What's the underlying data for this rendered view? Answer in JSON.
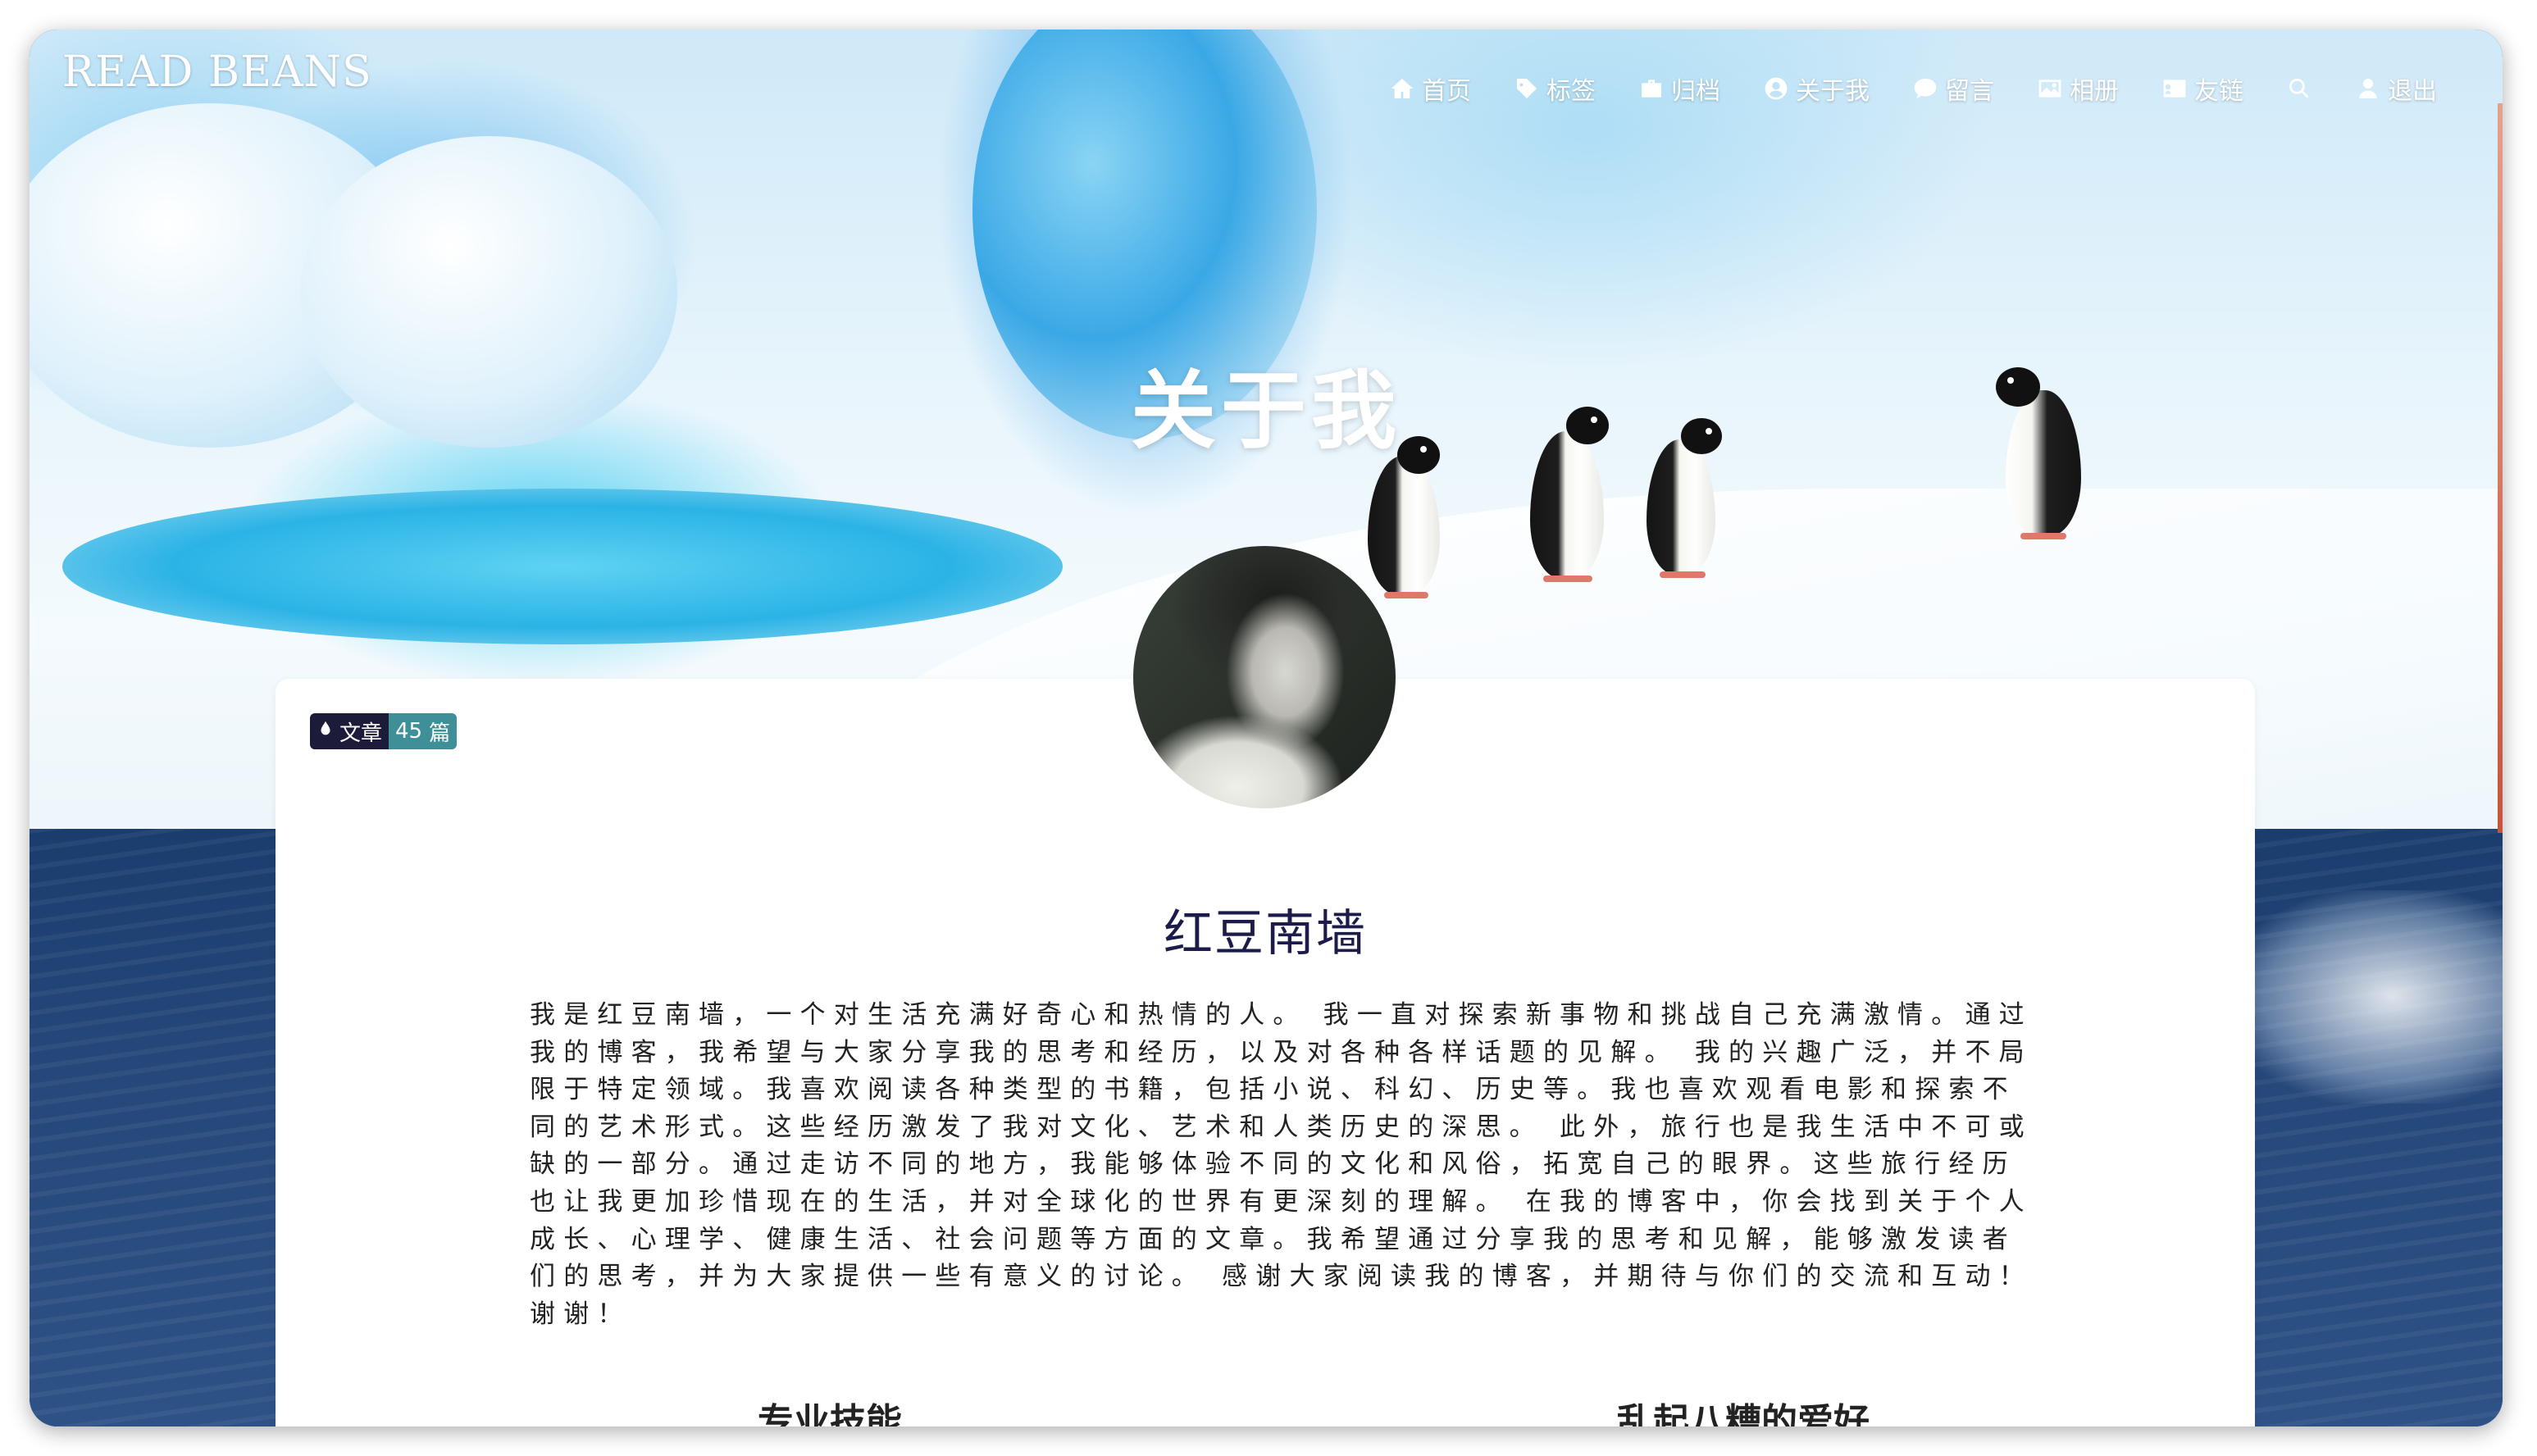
{
  "site": {
    "logo": "READ BEANS"
  },
  "nav": {
    "items": [
      {
        "label": "首页",
        "icon": "home-icon"
      },
      {
        "label": "标签",
        "icon": "tag-icon"
      },
      {
        "label": "归档",
        "icon": "briefcase-icon"
      },
      {
        "label": "关于我",
        "icon": "user-circle-icon"
      },
      {
        "label": "留言",
        "icon": "comment-icon"
      },
      {
        "label": "相册",
        "icon": "image-icon"
      },
      {
        "label": "友链",
        "icon": "id-card-icon"
      },
      {
        "label": "",
        "icon": "search-icon"
      },
      {
        "label": "退出",
        "icon": "user-icon"
      }
    ]
  },
  "hero": {
    "title": "关于我"
  },
  "card": {
    "badge": {
      "label": "文章",
      "count": "45",
      "unit": "篇",
      "icon": "water-drop-icon"
    },
    "author_name": "红豆南墙",
    "bio": "我是红豆南墙，一个对生活充满好奇心和热情的人。 我一直对探索新事物和挑战自己充满激情。通过我的博客，我希望与大家分享我的思考和经历，以及对各种各样话题的见解。 我的兴趣广泛，并不局限于特定领域。我喜欢阅读各种类型的书籍，包括小说、科幻、历史等。我也喜欢观看电影和探索不同的艺术形式。这些经历激发了我对文化、艺术和人类历史的深思。 此外，旅行也是我生活中不可或缺的一部分。通过走访不同的地方，我能够体验不同的文化和风俗，拓宽自己的眼界。这些旅行经历也让我更加珍惜现在的生活，并对全球化的世界有更深刻的理解。 在我的博客中，你会找到关于个人成长、心理学、健康生活、社会问题等方面的文章。我希望通过分享我的思考和见解，能够激发读者们的思考，并为大家提供一些有意义的讨论。 感谢大家阅读我的博客，并期待与你们的交流和互动！ 谢谢！",
    "sections": {
      "skills": "专业技能",
      "hobbies": "乱起八糟的爱好"
    }
  },
  "colors": {
    "name": "#1c1c4a",
    "badge_dark": "#1c1c3a",
    "badge_teal": "#3e8f97"
  }
}
